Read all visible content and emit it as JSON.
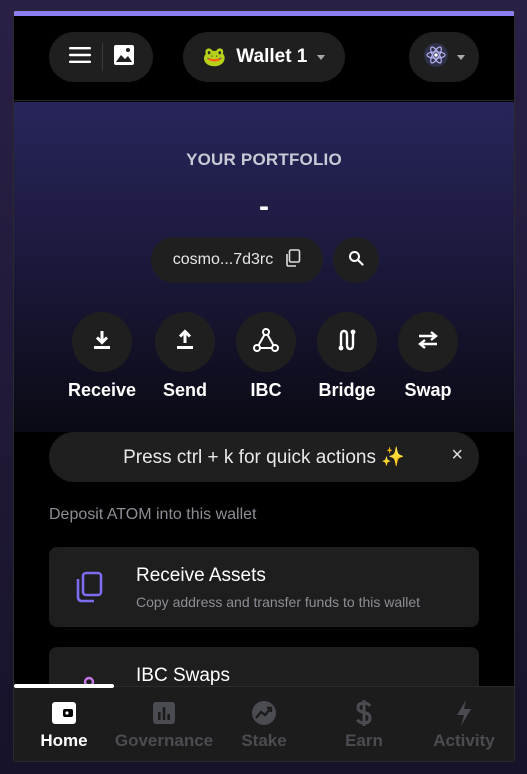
{
  "header": {
    "wallet_emoji": "🐸",
    "wallet_name": "Wallet 1",
    "icons": [
      "menu-icon",
      "image-icon",
      "chain-avatar-icon"
    ]
  },
  "portfolio": {
    "label": "YOUR PORTFOLIO",
    "balance": "-",
    "address": "cosmo...7d3rc"
  },
  "actions": [
    {
      "label": "Receive",
      "icon": "download-icon"
    },
    {
      "label": "Send",
      "icon": "upload-icon"
    },
    {
      "label": "IBC",
      "icon": "ibc-triangle-icon"
    },
    {
      "label": "Bridge",
      "icon": "bridge-icon"
    },
    {
      "label": "Swap",
      "icon": "swap-arrows-icon"
    }
  ],
  "quick_actions": {
    "text": "Press ctrl + k for quick actions ✨",
    "close": "×"
  },
  "deposit": {
    "label": "Deposit ATOM into this wallet",
    "cards": [
      {
        "title": "Receive Assets",
        "subtitle": "Copy address and transfer funds to this wallet",
        "icon": "copy-icon"
      },
      {
        "title": "IBC Swaps",
        "subtitle": "",
        "icon": "ibc-icon"
      }
    ]
  },
  "nav": [
    {
      "label": "Home",
      "icon": "wallet-icon",
      "active": true
    },
    {
      "label": "Governance",
      "icon": "bar-chart-icon",
      "active": false
    },
    {
      "label": "Stake",
      "icon": "stake-icon",
      "active": false
    },
    {
      "label": "Earn",
      "icon": "dollar-icon",
      "active": false
    },
    {
      "label": "Activity",
      "icon": "bolt-icon",
      "active": false
    }
  ],
  "colors": {
    "accent": "#8b7cf0",
    "card_icon": "#7b6cf0",
    "ibc_icon": "#c879e8"
  }
}
